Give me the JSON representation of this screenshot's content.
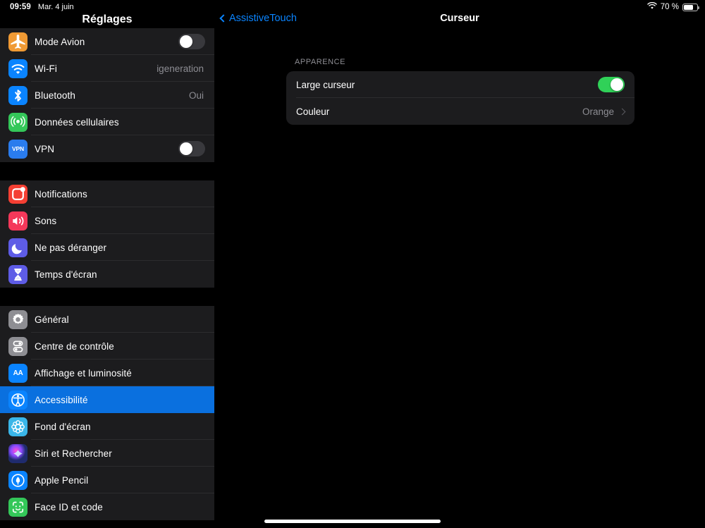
{
  "status_bar": {
    "time": "09:59",
    "date": "Mar. 4 juin",
    "battery_percent": "70 %",
    "wifi_icon": "wifi-icon",
    "battery_icon": "battery-icon"
  },
  "sidebar": {
    "title": "Réglages",
    "groups": [
      {
        "items": [
          {
            "label": "Mode Avion",
            "icon": "airplane-icon",
            "icon_bg": "#f09a34",
            "control": "toggle",
            "toggle_on": false
          },
          {
            "label": "Wi-Fi",
            "icon": "wifi-icon",
            "icon_bg": "#0a84ff",
            "control": "value",
            "value": "igeneration"
          },
          {
            "label": "Bluetooth",
            "icon": "bluetooth-icon",
            "icon_bg": "#0a84ff",
            "control": "value",
            "value": "Oui"
          },
          {
            "label": "Données cellulaires",
            "icon": "cellular-antenna-icon",
            "icon_bg": "#34c759",
            "control": "none",
            "value": ""
          },
          {
            "label": "VPN",
            "icon": "vpn-icon",
            "icon_bg": "#2a7ced",
            "control": "toggle",
            "toggle_on": false
          }
        ]
      },
      {
        "items": [
          {
            "label": "Notifications",
            "icon": "notifications-icon",
            "icon_bg": "#f43f33",
            "control": "none",
            "value": ""
          },
          {
            "label": "Sons",
            "icon": "speaker-icon",
            "icon_bg": "#f4385a",
            "control": "none",
            "value": ""
          },
          {
            "label": "Ne pas déranger",
            "icon": "moon-icon",
            "icon_bg": "#5e5ce6",
            "control": "none",
            "value": ""
          },
          {
            "label": "Temps d'écran",
            "icon": "hourglass-icon",
            "icon_bg": "#5e5ce6",
            "control": "none",
            "value": ""
          }
        ]
      },
      {
        "items": [
          {
            "label": "Général",
            "icon": "gear-icon",
            "icon_bg": "#8e8e93",
            "control": "none",
            "value": "",
            "selected": false
          },
          {
            "label": "Centre de contrôle",
            "icon": "control-center-icon",
            "icon_bg": "#8e8e93",
            "control": "none",
            "value": "",
            "selected": false
          },
          {
            "label": "Affichage et luminosité",
            "icon": "display-brightness-icon",
            "icon_bg": "#0a84ff",
            "control": "none",
            "value": "",
            "selected": false
          },
          {
            "label": "Accessibilité",
            "icon": "accessibility-icon",
            "icon_bg": "#0a84ff",
            "control": "none",
            "value": "",
            "selected": true
          },
          {
            "label": "Fond d'écran",
            "icon": "wallpaper-icon",
            "icon_bg": "#3ab6e8",
            "control": "none",
            "value": "",
            "selected": false
          },
          {
            "label": "Siri et Rechercher",
            "icon": "siri-icon",
            "icon_bg": "#2b2b40",
            "control": "none",
            "value": "",
            "selected": false
          },
          {
            "label": "Apple Pencil",
            "icon": "apple-pencil-icon",
            "icon_bg": "#0a84ff",
            "control": "none",
            "value": "",
            "selected": false
          },
          {
            "label": "Face ID et code",
            "icon": "face-id-icon",
            "icon_bg": "#34c759",
            "control": "none",
            "value": "",
            "selected": false
          }
        ]
      }
    ]
  },
  "detail": {
    "back_label": "AssistiveTouch",
    "back_icon": "chevron-left-icon",
    "title": "Curseur",
    "section_header": "APPARENCE",
    "rows": [
      {
        "label": "Large curseur",
        "control": "toggle",
        "toggle_on": true,
        "value": ""
      },
      {
        "label": "Couleur",
        "control": "disclosure",
        "value": "Orange",
        "chevron_icon": "chevron-right-icon"
      }
    ]
  },
  "home_indicator": "home-indicator",
  "colors": {
    "accent_blue": "#0a84ff",
    "selected_row": "#0a70df",
    "toggle_on_green": "#30d158",
    "toggle_off_grey": "#39393d",
    "card_bg": "#1c1c1e",
    "page_bg": "#000000",
    "secondary_text": "#8d8d93"
  }
}
